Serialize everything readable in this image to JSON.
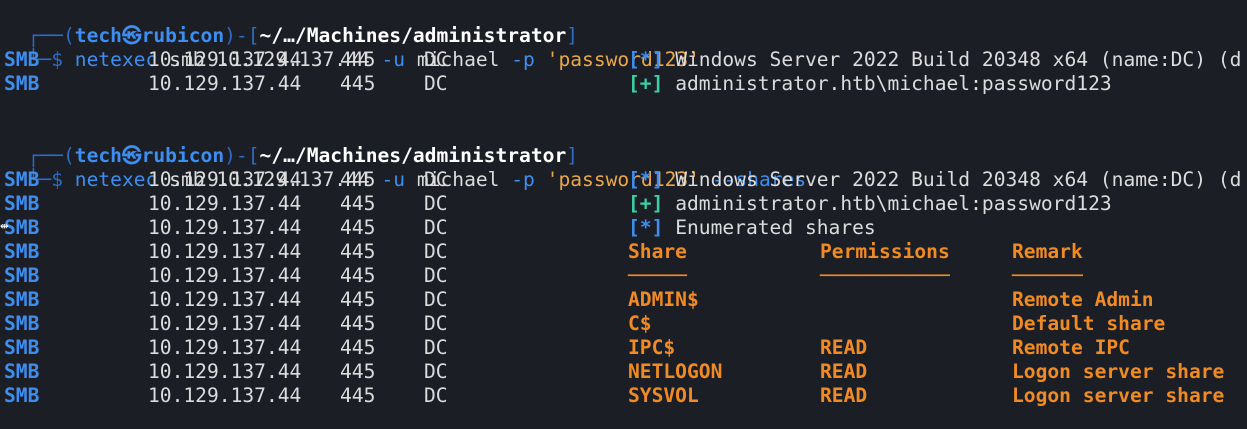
{
  "prompt": {
    "box_open": "┌──(",
    "user": "tech",
    "skull": "㉿",
    "host": "rubicon",
    "box_mid": ")-[",
    "path1": "~/…/Machines/administrator",
    "path2": "~/…/Machines/administrator",
    "box_close": "]",
    "corner": "└─",
    "dollar": "$"
  },
  "commands": [
    {
      "tool": "netexec",
      "proto": "smb",
      "target": "10.129.137.44",
      "uflag": "-u",
      "user": "michael",
      "pflag": "-p",
      "password": "'password123'",
      "extra": ""
    },
    {
      "tool": "netexec",
      "proto": "smb",
      "target": "10.129.137.44",
      "uflag": "-u",
      "user": "michael",
      "pflag": "-p",
      "password": "'password123'",
      "extra": "--shares"
    }
  ],
  "host_cols": {
    "proto": "SMB",
    "ip": "10.129.137.44",
    "port": "445",
    "name": "DC"
  },
  "messages": {
    "info_tag": "[*]",
    "ok_tag": "[+]",
    "banner": "Windows Server 2022 Build 20348 x64 (name:DC) (d",
    "auth": "administrator.htb\\michael:password123",
    "enum": "Enumerated shares"
  },
  "share_table": {
    "headers": [
      "Share",
      "Permissions",
      "Remark"
    ],
    "underlines": [
      "─────",
      "───────────",
      "──────"
    ],
    "rows": [
      {
        "share": "ADMIN$",
        "perm": "",
        "remark": "Remote Admin"
      },
      {
        "share": "C$",
        "perm": "",
        "remark": "Default share"
      },
      {
        "share": "IPC$",
        "perm": "READ",
        "remark": "Remote IPC"
      },
      {
        "share": "NETLOGON",
        "perm": "READ",
        "remark": "Logon server share"
      },
      {
        "share": "SYSVOL",
        "perm": "READ",
        "remark": "Logon server share"
      }
    ]
  },
  "colors": {
    "background": "#1c1e26",
    "blue": "#3d8ef0",
    "orange": "#f08a24",
    "green": "#3ccfa0",
    "string": "#e9a74a"
  }
}
